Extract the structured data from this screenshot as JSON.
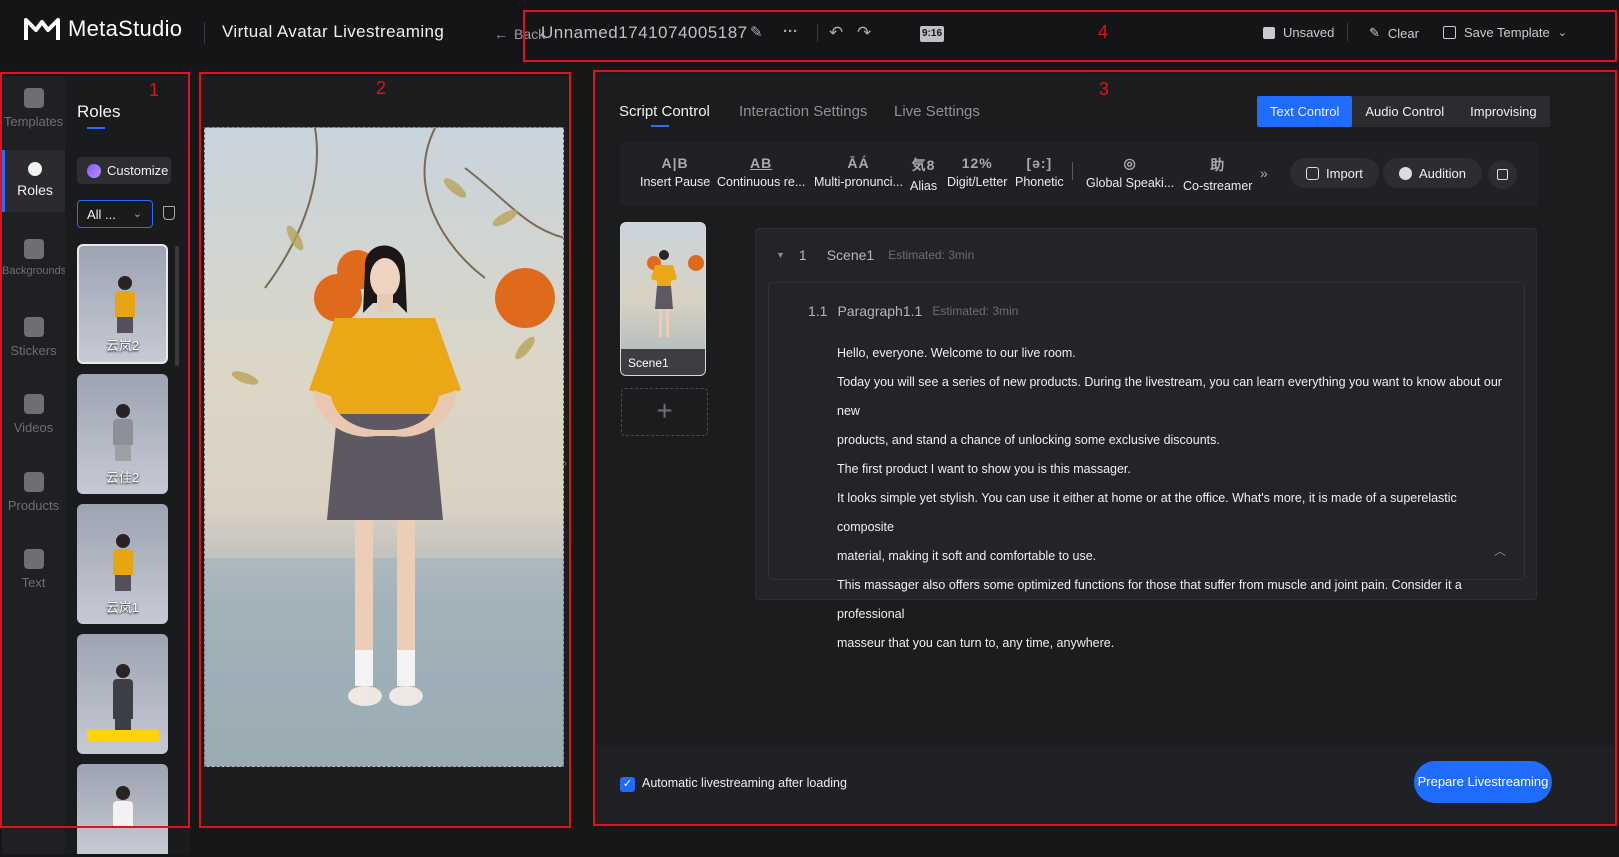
{
  "header": {
    "brand": "MetaStudio",
    "app_title": "Virtual Avatar Livestreaming",
    "back_label": "Back",
    "doc_name": "Unnamed1741074005187",
    "ratio": "9:16",
    "unsaved_label": "Unsaved",
    "clear_label": "Clear",
    "save_template_label": "Save Template",
    "icons": [
      "edit-icon",
      "more-icon",
      "undo-icon",
      "redo-icon",
      "save-icon",
      "brush-icon",
      "template-icon",
      "chevron-down-icon"
    ]
  },
  "annotations": [
    "1",
    "2",
    "3",
    "4"
  ],
  "rail": {
    "items": [
      {
        "label": "Templates",
        "icon": "cube-icon"
      },
      {
        "label": "Roles",
        "icon": "person-icon",
        "active": true
      },
      {
        "label": "Backgrounds",
        "icon": "background-icon"
      },
      {
        "label": "Stickers",
        "icon": "sticker-icon"
      },
      {
        "label": "Videos",
        "icon": "video-icon"
      },
      {
        "label": "Products",
        "icon": "bag-icon"
      },
      {
        "label": "Text",
        "icon": "text-icon"
      }
    ]
  },
  "roles": {
    "title": "Roles",
    "customize_label": "Customize",
    "filter_value": "All ...",
    "cards": [
      {
        "name": "云岚2",
        "shirt": "#e8a512",
        "selected": true
      },
      {
        "name": "云佳2",
        "shirt": "#8d9096",
        "selected": false
      },
      {
        "name": "云岚1",
        "shirt": "#e8a512",
        "selected": false
      },
      {
        "name": "",
        "shirt": "#3d3f45",
        "selected": false
      },
      {
        "name": "",
        "shirt": "#f2f2f2",
        "selected": false
      }
    ]
  },
  "right": {
    "tabs": [
      "Script Control",
      "Interaction Settings",
      "Live Settings"
    ],
    "mode_buttons": [
      "Text Control",
      "Audio Control",
      "Improvising"
    ],
    "tools": [
      {
        "glyph": "A|B",
        "label": "Insert Pause"
      },
      {
        "glyph": "AB",
        "label": "Continuous re..."
      },
      {
        "glyph": "ĀÁ",
        "label": "Multi-pronunci..."
      },
      {
        "glyph": "気8",
        "label": "Alias"
      },
      {
        "glyph": "12%",
        "label": "Digit/Letter"
      },
      {
        "glyph": "[ə:]",
        "label": "Phonetic"
      },
      {
        "glyph": "◎",
        "label": "Global Speaki..."
      },
      {
        "glyph": "助",
        "label": "Co-streamer"
      }
    ],
    "import_label": "Import",
    "audition_label": "Audition",
    "scene_thumb_label": "Scene1",
    "scene": {
      "index": "1",
      "name": "Scene1",
      "estimate": "Estimated: 3min",
      "paragraph": {
        "index": "1.1",
        "name": "Paragraph1.1",
        "estimate": "Estimated: 3min",
        "lines": [
          "Hello, everyone. Welcome to our live room.",
          "Today you will see a series of new products. During the livestream, you can learn everything you want to know about our new",
          "products, and stand a chance of unlocking some exclusive discounts.",
          "The first product I want to show you is this massager.",
          "It looks simple yet stylish. You can use it either at home or at the office. What's more, it is made of a superelastic composite",
          "material, making it soft and comfortable to use.",
          "This massager also offers some optimized functions for those that suffer from muscle and joint pain. Consider it a professional",
          "masseur that you can turn to, any time, anywhere."
        ]
      }
    },
    "auto_stream_label": "Automatic livestreaming after loading",
    "auto_stream_checked": true,
    "prepare_label": "Prepare Livestreaming"
  },
  "colors": {
    "accent": "#1f6cff",
    "annotation": "#e0121b"
  }
}
